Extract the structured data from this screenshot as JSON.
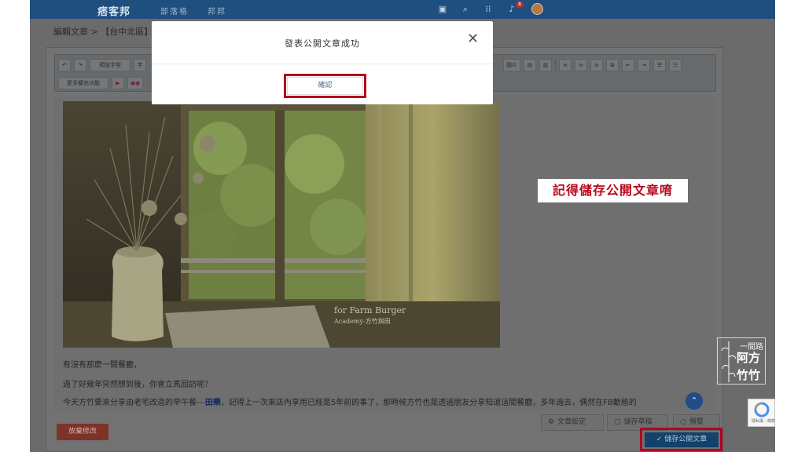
{
  "header": {
    "logo": "痞客邦",
    "nav": [
      "部落格",
      "邦邦"
    ],
    "notification_count": "8"
  },
  "breadcrumb": "編輯文章 > 【台中北區】",
  "toolbar": {
    "row1": [
      "↶",
      "↷",
      "預設字型",
      "字"
    ],
    "row1_right": [
      "圖片",
      "",
      "",
      "",
      "",
      "",
      "",
      "",
      "",
      "",
      ""
    ],
    "row2": [
      "更多擴充功能",
      "▶",
      "●●"
    ]
  },
  "article": {
    "paragraphs": [
      "有沒有那麼一間餐廳，",
      "過了好幾年突然想到後，你會立馬回訪呢？"
    ],
    "para3_before": "今天方竹要來分享由老宅改造的早午餐---",
    "para3_highlight": "田樂",
    "para3_after": "，記得上一次來店內享用已經是5年前的事了，那時候方竹也是透過朋友分享知道這間餐廳，多年過去，偶然在FB動態的",
    "photo_caption_line1": "for Farm Burger",
    "photo_caption_line2": "Academy-方竹與田"
  },
  "callout": "記得儲存公開文章唷",
  "watermark": {
    "small": "一間路",
    "line1": "阿方",
    "line2": "竹竹"
  },
  "recaptcha": {
    "label": "隱私權 - 條款"
  },
  "buttons": {
    "discard": "放棄修改",
    "article_settings": "文章設定",
    "save_draft": "儲存草稿",
    "preview": "預覽",
    "publish": "儲存公開文章"
  },
  "modal": {
    "title": "發表公開文章成功",
    "close": "✕",
    "confirm": "確認"
  },
  "colors": {
    "nav_bg": "#1e4f7f",
    "highlight_red": "#b3001f",
    "publish_blue": "#12416a"
  }
}
